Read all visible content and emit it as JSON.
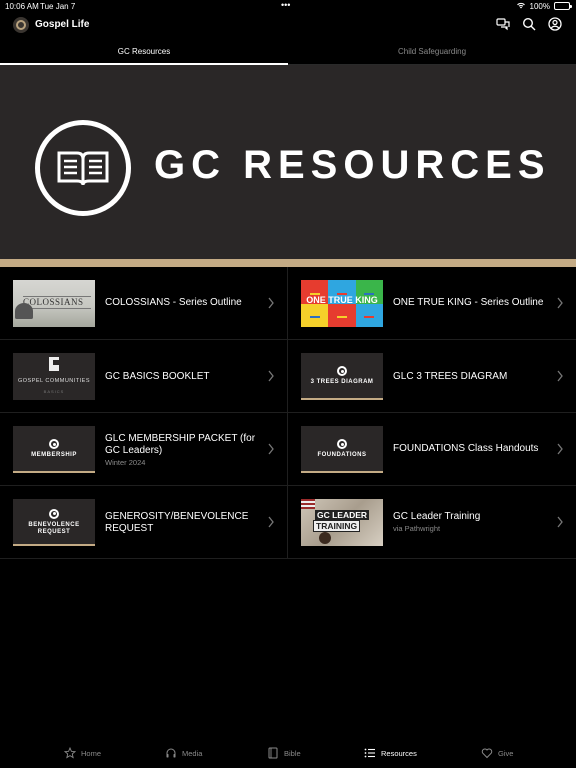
{
  "status": {
    "time": "10:06 AM",
    "date": "Tue Jan 7",
    "dots": "•••",
    "battery": "100%"
  },
  "header": {
    "app_title": "Gospel Life"
  },
  "tabs": [
    {
      "label": "GC Resources",
      "active": true
    },
    {
      "label": "Child Safeguarding",
      "active": false
    }
  ],
  "banner": {
    "title": "GC RESOURCES"
  },
  "items": [
    {
      "title": "COLOSSIANS - Series Outline",
      "subtitle": "",
      "thumb": {
        "type": "photo",
        "text": "COLOSSIANS"
      }
    },
    {
      "title": "ONE TRUE KING - Series Outline",
      "subtitle": "",
      "thumb": {
        "type": "grid",
        "text": "ONE TRUE KING",
        "colors": [
          "#e63c2f",
          "#2fa6e0",
          "#3ab54a",
          "#f5d02a",
          "#e63c2f",
          "#2fa6e0"
        ]
      }
    },
    {
      "title": "GC BASICS BOOKLET",
      "subtitle": "",
      "thumb": {
        "type": "booklet",
        "text": "GOSPEL COMMUNITIES",
        "text2": "BASICS"
      }
    },
    {
      "title": "GLC 3 TREES DIAGRAM",
      "subtitle": "",
      "thumb": {
        "type": "plate",
        "text": "3 TREES DIAGRAM"
      }
    },
    {
      "title": "GLC MEMBERSHIP PACKET (for GC Leaders)",
      "subtitle": "Winter 2024",
      "thumb": {
        "type": "plate",
        "text": "MEMBERSHIP"
      }
    },
    {
      "title": "FOUNDATIONS Class Handouts",
      "subtitle": "",
      "thumb": {
        "type": "plate",
        "text": "FOUNDATIONS"
      }
    },
    {
      "title": "GENEROSITY/BENEVOLENCE REQUEST",
      "subtitle": "",
      "thumb": {
        "type": "plate",
        "text": "BENEVOLENCE REQUEST"
      }
    },
    {
      "title": "GC Leader Training",
      "subtitle": "via Pathwright",
      "thumb": {
        "type": "photo2",
        "text": "GC LEADER",
        "text2": "TRAINING"
      }
    }
  ],
  "nav": [
    {
      "label": "Home",
      "icon": "star-icon",
      "active": false
    },
    {
      "label": "Media",
      "icon": "headphones-icon",
      "active": false
    },
    {
      "label": "Bible",
      "icon": "book-icon",
      "active": false
    },
    {
      "label": "Resources",
      "icon": "list-icon",
      "active": true
    },
    {
      "label": "Give",
      "icon": "heart-icon",
      "active": false
    }
  ],
  "colors": {
    "accent": "#c4ab85",
    "background": "#000000",
    "banner": "#2a2727"
  }
}
